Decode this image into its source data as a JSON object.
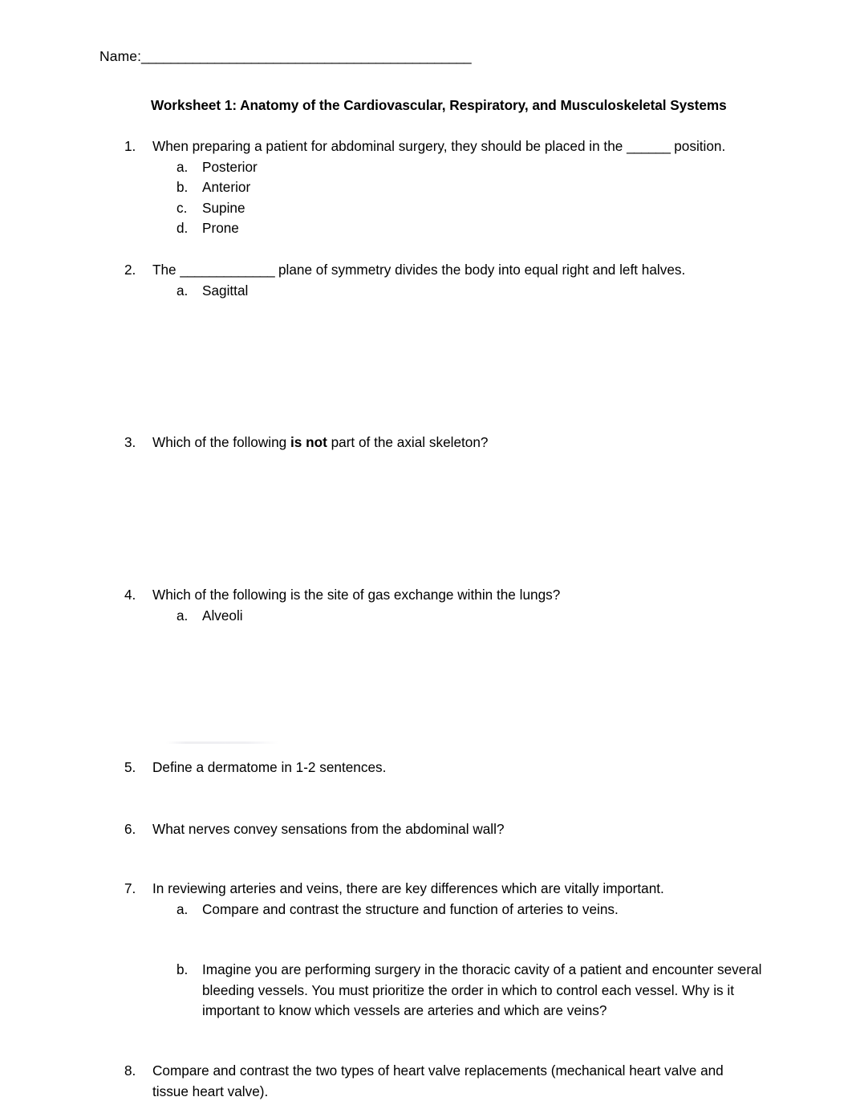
{
  "header": {
    "name_label": "Name:",
    "name_blank": "_____________________________________________"
  },
  "title": "Worksheet 1: Anatomy of the Cardiovascular, Respiratory, and Musculoskeletal Systems",
  "questions": [
    {
      "number": "1.",
      "text_before": "When preparing a patient for abdominal surgery, they should be placed in the ",
      "blank": "______",
      "text_after": " position.",
      "options": [
        {
          "mark": "a.",
          "text": "Posterior"
        },
        {
          "mark": "b.",
          "text": "Anterior"
        },
        {
          "mark": "c.",
          "text": "Supine"
        },
        {
          "mark": "d.",
          "text": "Prone"
        }
      ]
    },
    {
      "number": "2.",
      "text_before": "The ",
      "blank": "_____________",
      "text_after": " plane of symmetry divides the body into equal right and left halves.",
      "options": [
        {
          "mark": "a.",
          "text": "Sagittal"
        }
      ]
    },
    {
      "number": "3.",
      "text_part1": "Which of the following ",
      "bold": "is not",
      "text_part2": " part of the axial skeleton?",
      "options": []
    },
    {
      "number": "4.",
      "text": "Which of the following is the site of gas exchange within the lungs?",
      "options": [
        {
          "mark": "a.",
          "text": "Alveoli"
        }
      ]
    },
    {
      "number": "5.",
      "text": "Define a dermatome in 1-2 sentences.",
      "options": []
    },
    {
      "number": "6.",
      "text": "What nerves convey sensations from the abdominal wall?",
      "options": []
    },
    {
      "number": "7.",
      "text": "In reviewing arteries and veins, there are key differences which are vitally important.",
      "options": [
        {
          "mark": "a.",
          "text": "Compare and contrast the structure and function of arteries to veins."
        },
        {
          "mark": "b.",
          "text": "Imagine you are performing surgery in the thoracic cavity of a patient and encounter several bleeding vessels. You must prioritize the order in which to control each vessel. Why is it important to know which vessels are arteries and which are veins?"
        }
      ]
    },
    {
      "number": "8.",
      "text": "Compare and contrast the two types of heart valve replacements (mechanical heart valve and tissue heart valve).",
      "options": []
    }
  ]
}
